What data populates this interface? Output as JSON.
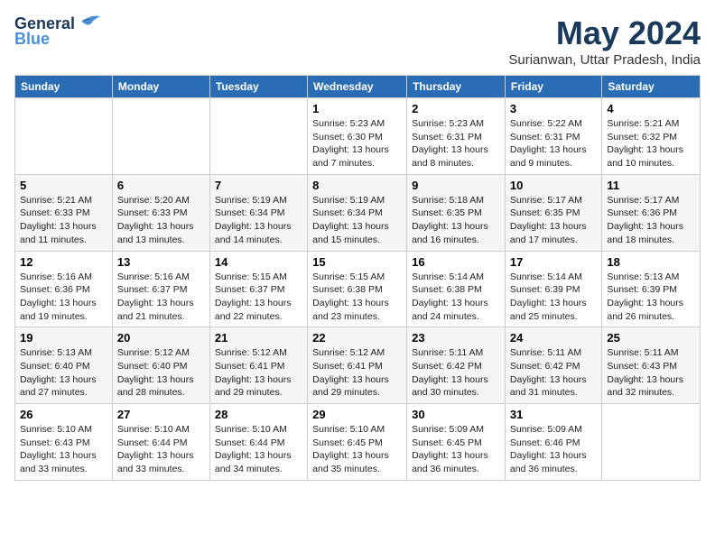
{
  "header": {
    "logo_general": "General",
    "logo_blue": "Blue",
    "title": "May 2024",
    "location": "Surianwan, Uttar Pradesh, India"
  },
  "days_of_week": [
    "Sunday",
    "Monday",
    "Tuesday",
    "Wednesday",
    "Thursday",
    "Friday",
    "Saturday"
  ],
  "weeks": [
    [
      {
        "day": "",
        "info": ""
      },
      {
        "day": "",
        "info": ""
      },
      {
        "day": "",
        "info": ""
      },
      {
        "day": "1",
        "info": "Sunrise: 5:23 AM\nSunset: 6:30 PM\nDaylight: 13 hours\nand 7 minutes."
      },
      {
        "day": "2",
        "info": "Sunrise: 5:23 AM\nSunset: 6:31 PM\nDaylight: 13 hours\nand 8 minutes."
      },
      {
        "day": "3",
        "info": "Sunrise: 5:22 AM\nSunset: 6:31 PM\nDaylight: 13 hours\nand 9 minutes."
      },
      {
        "day": "4",
        "info": "Sunrise: 5:21 AM\nSunset: 6:32 PM\nDaylight: 13 hours\nand 10 minutes."
      }
    ],
    [
      {
        "day": "5",
        "info": "Sunrise: 5:21 AM\nSunset: 6:33 PM\nDaylight: 13 hours\nand 11 minutes."
      },
      {
        "day": "6",
        "info": "Sunrise: 5:20 AM\nSunset: 6:33 PM\nDaylight: 13 hours\nand 13 minutes."
      },
      {
        "day": "7",
        "info": "Sunrise: 5:19 AM\nSunset: 6:34 PM\nDaylight: 13 hours\nand 14 minutes."
      },
      {
        "day": "8",
        "info": "Sunrise: 5:19 AM\nSunset: 6:34 PM\nDaylight: 13 hours\nand 15 minutes."
      },
      {
        "day": "9",
        "info": "Sunrise: 5:18 AM\nSunset: 6:35 PM\nDaylight: 13 hours\nand 16 minutes."
      },
      {
        "day": "10",
        "info": "Sunrise: 5:17 AM\nSunset: 6:35 PM\nDaylight: 13 hours\nand 17 minutes."
      },
      {
        "day": "11",
        "info": "Sunrise: 5:17 AM\nSunset: 6:36 PM\nDaylight: 13 hours\nand 18 minutes."
      }
    ],
    [
      {
        "day": "12",
        "info": "Sunrise: 5:16 AM\nSunset: 6:36 PM\nDaylight: 13 hours\nand 19 minutes."
      },
      {
        "day": "13",
        "info": "Sunrise: 5:16 AM\nSunset: 6:37 PM\nDaylight: 13 hours\nand 21 minutes."
      },
      {
        "day": "14",
        "info": "Sunrise: 5:15 AM\nSunset: 6:37 PM\nDaylight: 13 hours\nand 22 minutes."
      },
      {
        "day": "15",
        "info": "Sunrise: 5:15 AM\nSunset: 6:38 PM\nDaylight: 13 hours\nand 23 minutes."
      },
      {
        "day": "16",
        "info": "Sunrise: 5:14 AM\nSunset: 6:38 PM\nDaylight: 13 hours\nand 24 minutes."
      },
      {
        "day": "17",
        "info": "Sunrise: 5:14 AM\nSunset: 6:39 PM\nDaylight: 13 hours\nand 25 minutes."
      },
      {
        "day": "18",
        "info": "Sunrise: 5:13 AM\nSunset: 6:39 PM\nDaylight: 13 hours\nand 26 minutes."
      }
    ],
    [
      {
        "day": "19",
        "info": "Sunrise: 5:13 AM\nSunset: 6:40 PM\nDaylight: 13 hours\nand 27 minutes."
      },
      {
        "day": "20",
        "info": "Sunrise: 5:12 AM\nSunset: 6:40 PM\nDaylight: 13 hours\nand 28 minutes."
      },
      {
        "day": "21",
        "info": "Sunrise: 5:12 AM\nSunset: 6:41 PM\nDaylight: 13 hours\nand 29 minutes."
      },
      {
        "day": "22",
        "info": "Sunrise: 5:12 AM\nSunset: 6:41 PM\nDaylight: 13 hours\nand 29 minutes."
      },
      {
        "day": "23",
        "info": "Sunrise: 5:11 AM\nSunset: 6:42 PM\nDaylight: 13 hours\nand 30 minutes."
      },
      {
        "day": "24",
        "info": "Sunrise: 5:11 AM\nSunset: 6:42 PM\nDaylight: 13 hours\nand 31 minutes."
      },
      {
        "day": "25",
        "info": "Sunrise: 5:11 AM\nSunset: 6:43 PM\nDaylight: 13 hours\nand 32 minutes."
      }
    ],
    [
      {
        "day": "26",
        "info": "Sunrise: 5:10 AM\nSunset: 6:43 PM\nDaylight: 13 hours\nand 33 minutes."
      },
      {
        "day": "27",
        "info": "Sunrise: 5:10 AM\nSunset: 6:44 PM\nDaylight: 13 hours\nand 33 minutes."
      },
      {
        "day": "28",
        "info": "Sunrise: 5:10 AM\nSunset: 6:44 PM\nDaylight: 13 hours\nand 34 minutes."
      },
      {
        "day": "29",
        "info": "Sunrise: 5:10 AM\nSunset: 6:45 PM\nDaylight: 13 hours\nand 35 minutes."
      },
      {
        "day": "30",
        "info": "Sunrise: 5:09 AM\nSunset: 6:45 PM\nDaylight: 13 hours\nand 36 minutes."
      },
      {
        "day": "31",
        "info": "Sunrise: 5:09 AM\nSunset: 6:46 PM\nDaylight: 13 hours\nand 36 minutes."
      },
      {
        "day": "",
        "info": ""
      }
    ]
  ]
}
